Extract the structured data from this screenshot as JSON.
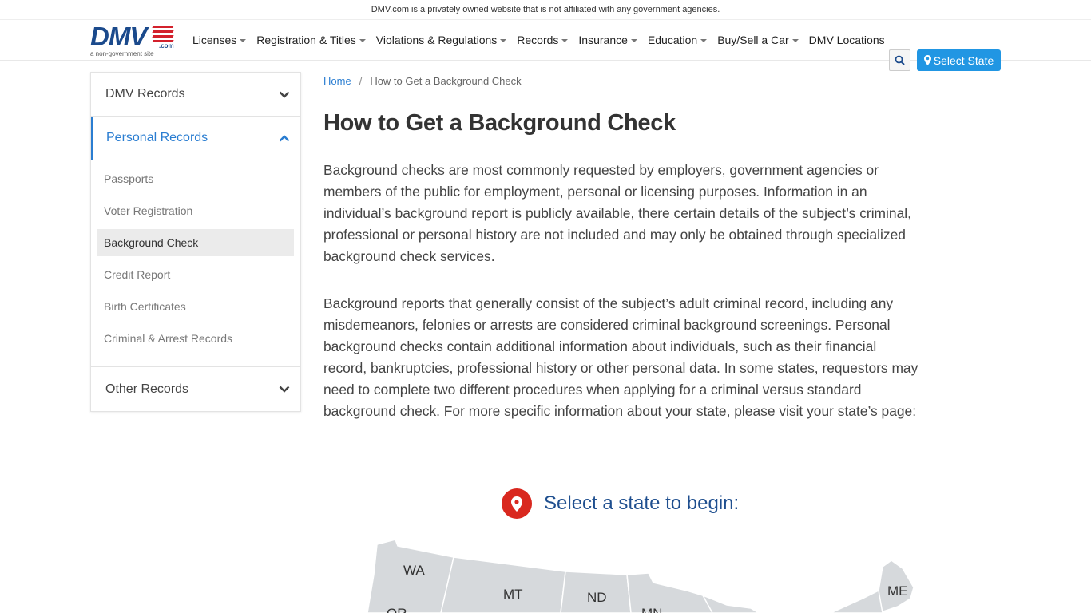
{
  "disclaimer": "DMV.com is a privately owned website that is not affiliated with any government agencies.",
  "logo": {
    "word": "DMV",
    "suffix": ".com",
    "tagline": "a non-government site"
  },
  "nav": {
    "items": [
      {
        "label": "Licenses",
        "dropdown": true
      },
      {
        "label": "Registration & Titles",
        "dropdown": true
      },
      {
        "label": "Violations & Regulations",
        "dropdown": true
      },
      {
        "label": "Records",
        "dropdown": true
      },
      {
        "label": "Insurance",
        "dropdown": true
      },
      {
        "label": "Education",
        "dropdown": true
      },
      {
        "label": "Buy/Sell a Car",
        "dropdown": true
      },
      {
        "label": "DMV Locations",
        "dropdown": false
      }
    ],
    "search_icon": "search-icon",
    "select_state_label": "Select State"
  },
  "sidebar": {
    "sections": [
      {
        "label": "DMV Records",
        "expanded": false
      },
      {
        "label": "Personal Records",
        "expanded": true
      },
      {
        "label": "Other Records",
        "expanded": false
      }
    ],
    "links": [
      {
        "label": "Passports"
      },
      {
        "label": "Voter Registration"
      },
      {
        "label": "Background Check",
        "current": true
      },
      {
        "label": "Credit Report"
      },
      {
        "label": "Birth Certificates"
      },
      {
        "label": "Criminal & Arrest Records"
      }
    ]
  },
  "breadcrumb": {
    "home": "Home",
    "separator": "/",
    "current": "How to Get a Background Check"
  },
  "main": {
    "title": "How to Get a Background Check",
    "paragraph1": "Background checks are most commonly requested by employers, government agencies or members of the public for employment, personal or licensing purposes. Information in an individual’s background report is publicly available, there certain details of the subject’s criminal, professional or personal history are not included and may only be obtained through specialized background check services.",
    "paragraph2": "Background reports that generally consist of the subject’s adult criminal record, including any misdemeanors, felonies or arrests are considered criminal background screenings. Personal background checks contain additional information about individuals, such as their financial record, bankruptcies, professional history or other personal data. In some states, requestors may need to complete two different procedures when applying for a criminal versus standard background check. For more specific information about your state, please visit your state’s page:",
    "state_prompt": "Select a state to begin:"
  },
  "map": {
    "states": [
      "WA",
      "MT",
      "ND",
      "MN",
      "OR",
      "ME"
    ]
  },
  "colors": {
    "brand_blue": "#1b4a8c",
    "link_blue": "#2a7dd1",
    "button_blue": "#2196e3",
    "pin_red": "#d9281f",
    "map_gray": "#d6d9dc"
  }
}
